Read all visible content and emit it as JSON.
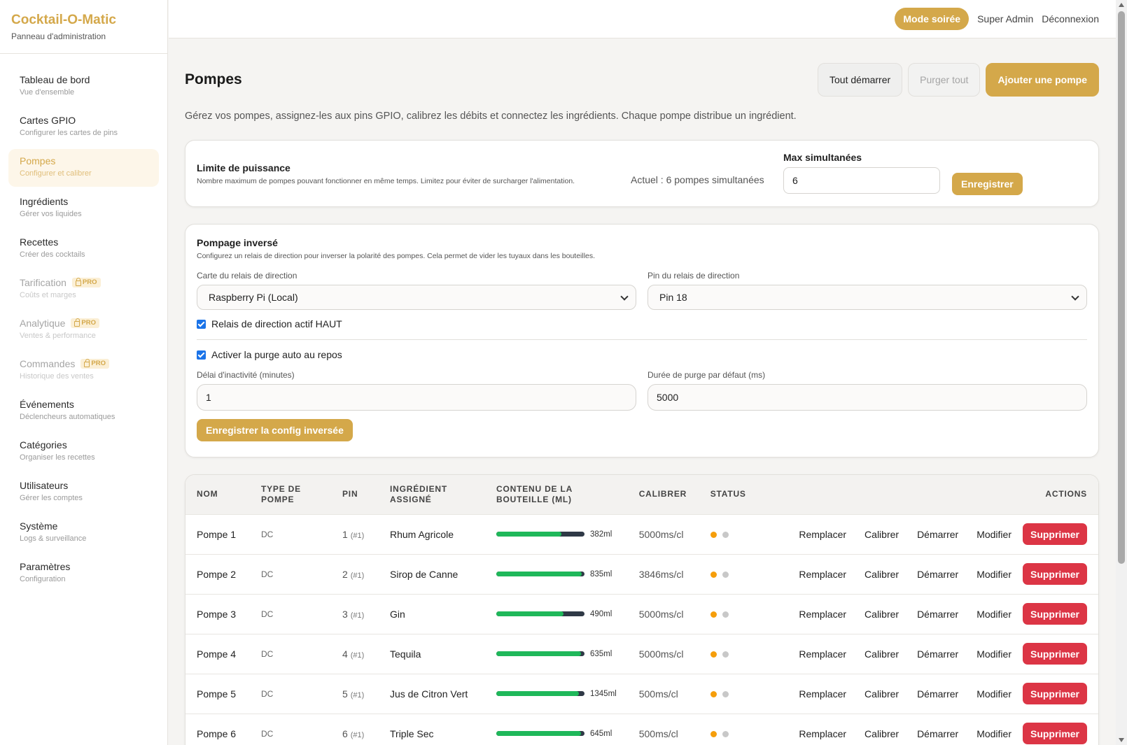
{
  "brand": {
    "title": "Cocktail-O-Matic",
    "subtitle": "Panneau d'administration"
  },
  "sidebar": {
    "items": [
      {
        "label": "Tableau de bord",
        "sub": "Vue d'ensemble"
      },
      {
        "label": "Cartes GPIO",
        "sub": "Configurer les cartes de pins"
      },
      {
        "label": "Pompes",
        "sub": "Configurer et calibrer"
      },
      {
        "label": "Ingrédients",
        "sub": "Gérer vos liquides"
      },
      {
        "label": "Recettes",
        "sub": "Créer des cocktails"
      },
      {
        "label": "Tarification",
        "sub": "Coûts et marges",
        "badge": "PRO"
      },
      {
        "label": "Analytique",
        "sub": "Ventes & performance",
        "badge": "PRO"
      },
      {
        "label": "Commandes",
        "sub": "Historique des ventes",
        "badge": "PRO"
      },
      {
        "label": "Événements",
        "sub": "Déclencheurs automatiques"
      },
      {
        "label": "Catégories",
        "sub": "Organiser les recettes"
      },
      {
        "label": "Utilisateurs",
        "sub": "Gérer les comptes"
      },
      {
        "label": "Système",
        "sub": "Logs & surveillance"
      },
      {
        "label": "Paramètres",
        "sub": "Configuration"
      }
    ]
  },
  "topbar": {
    "mode_label": "Mode soirée",
    "user": "Super Admin",
    "logout": "Déconnexion"
  },
  "page": {
    "title": "Pompes",
    "start_all": "Tout démarrer",
    "purge_all": "Purger tout",
    "add_pump": "Ajouter une pompe",
    "intro": "Gérez vos pompes, assignez-les aux pins GPIO, calibrez les débits et connectez les ingrédients. Chaque pompe distribue un ingrédient."
  },
  "power": {
    "title": "Limite de puissance",
    "desc": "Nombre maximum de pompes pouvant fonctionner en même temps. Limitez pour éviter de surcharger l'alimentation.",
    "current": "Actuel : 6 pompes simultanées",
    "max_label": "Max simultanées",
    "max_value": "6",
    "save": "Enregistrer"
  },
  "inverse": {
    "title": "Pompage inversé",
    "desc": "Configurez un relais de direction pour inverser la polarité des pompes. Cela permet de vider les tuyaux dans les bouteilles.",
    "board_label": "Carte du relais de direction",
    "board_value": "Raspberry Pi (Local)",
    "pin_label": "Pin du relais de direction",
    "pin_value": "Pin 18",
    "active_high": "Relais de direction actif HAUT",
    "auto_purge": "Activer la purge auto au repos",
    "idle_label": "Délai d'inactivité (minutes)",
    "idle_value": "1",
    "purge_label": "Durée de purge par défaut (ms)",
    "purge_value": "5000",
    "save": "Enregistrer la config inversée"
  },
  "table": {
    "headers": {
      "name": "NOM",
      "type": "TYPE DE POMPE",
      "pin": "PIN",
      "ingredient": "INGRÉDIENT ASSIGNÉ",
      "bottle": "CONTENU DE LA BOUTEILLE (ML)",
      "calib": "CALIBRER",
      "status": "STATUS",
      "actions": "ACTIONS"
    },
    "action_labels": {
      "replace": "Remplacer",
      "calibrate": "Calibrer",
      "start": "Démarrer",
      "edit": "Modifier",
      "delete": "Supprimer"
    },
    "rows": [
      {
        "name": "Pompe 1",
        "type": "DC",
        "pin": "1",
        "pin_sub": "(#1)",
        "ingredient": "Rhum Agricole",
        "ml": "382ml",
        "fill": 0.74,
        "calib": "5000ms/cl"
      },
      {
        "name": "Pompe 2",
        "type": "DC",
        "pin": "2",
        "pin_sub": "(#1)",
        "ingredient": "Sirop de Canne",
        "ml": "835ml",
        "fill": 0.97,
        "calib": "3846ms/cl"
      },
      {
        "name": "Pompe 3",
        "type": "DC",
        "pin": "3",
        "pin_sub": "(#1)",
        "ingredient": "Gin",
        "ml": "490ml",
        "fill": 0.76,
        "calib": "5000ms/cl"
      },
      {
        "name": "Pompe 4",
        "type": "DC",
        "pin": "4",
        "pin_sub": "(#1)",
        "ingredient": "Tequila",
        "ml": "635ml",
        "fill": 0.96,
        "calib": "5000ms/cl"
      },
      {
        "name": "Pompe 5",
        "type": "DC",
        "pin": "5",
        "pin_sub": "(#1)",
        "ingredient": "Jus de Citron Vert",
        "ml": "1345ml",
        "fill": 0.94,
        "calib": "500ms/cl"
      },
      {
        "name": "Pompe 6",
        "type": "DC",
        "pin": "6",
        "pin_sub": "(#1)",
        "ingredient": "Triple Sec",
        "ml": "645ml",
        "fill": 0.96,
        "calib": "500ms/cl"
      }
    ]
  }
}
